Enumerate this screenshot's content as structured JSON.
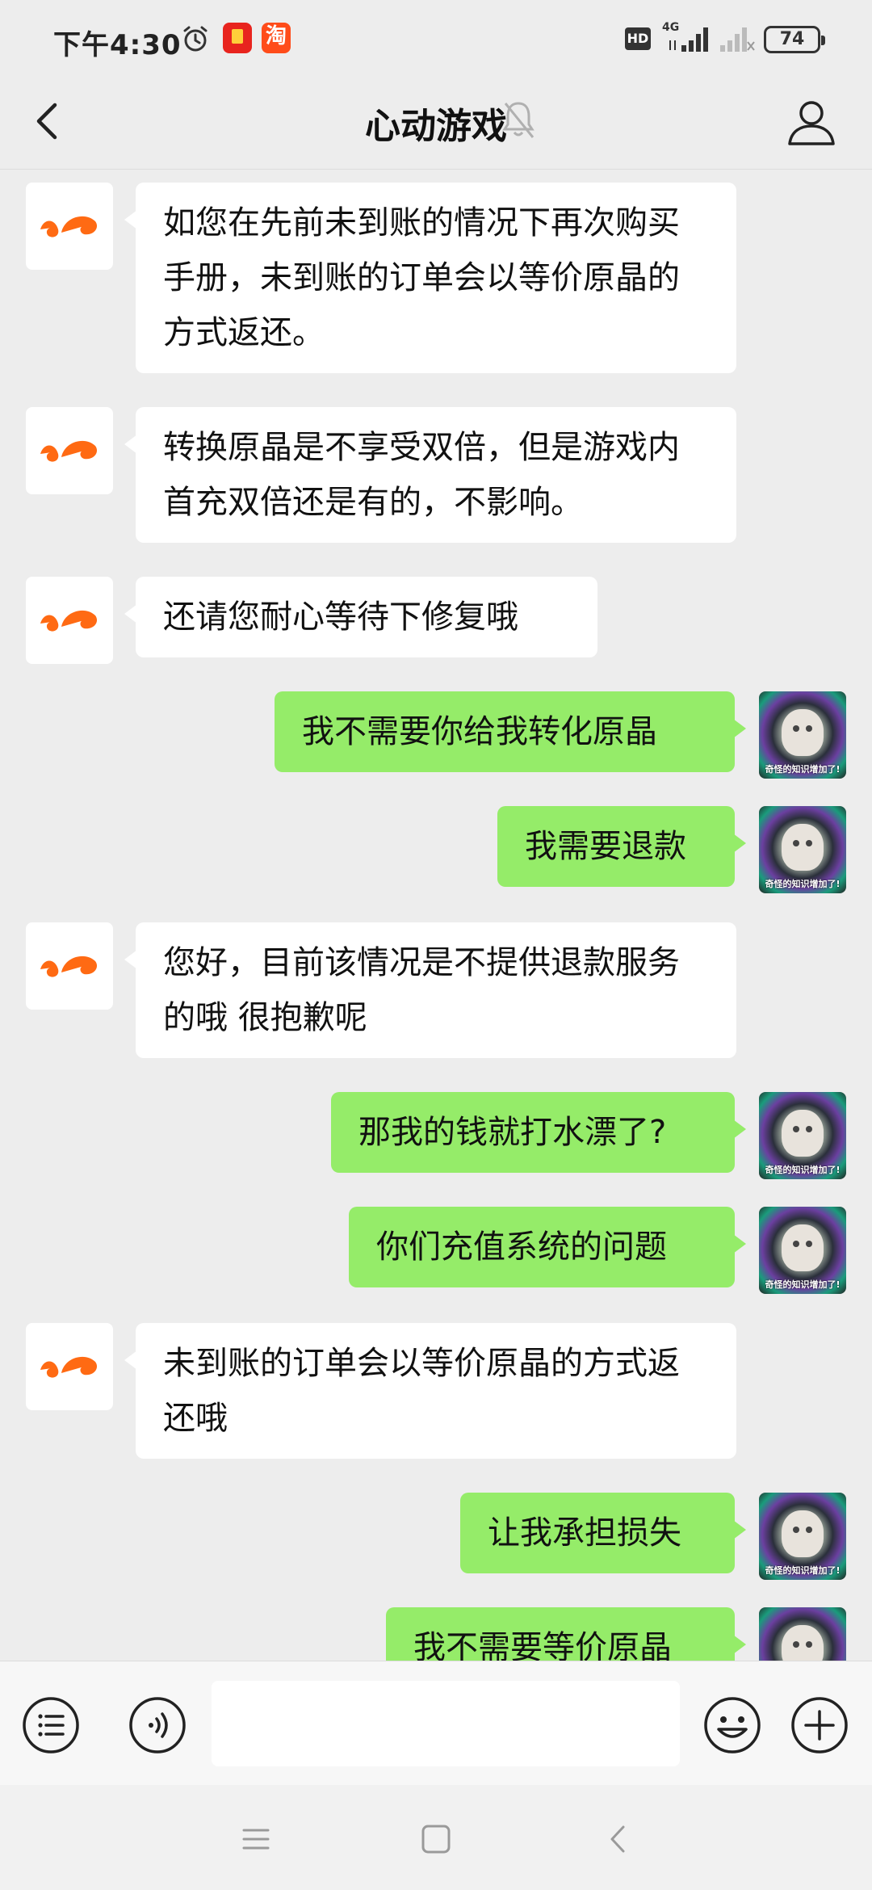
{
  "status_bar": {
    "time": "下午4:30",
    "hd": "HD",
    "network": "4G",
    "battery": "74",
    "taobao_glyph": "淘"
  },
  "nav": {
    "title": "心动游戏",
    "back_icon": "chevron-left-icon",
    "mute_icon": "bell-off-icon",
    "profile_icon": "person-icon"
  },
  "messages": [
    {
      "from": "business",
      "text": "如您在先前未到账的情况下再次购买手册，未到账的订单会以等价原晶的方式返还。"
    },
    {
      "from": "business",
      "text": "转换原晶是不享受双倍，但是游戏内首充双倍还是有的，不影响。"
    },
    {
      "from": "business",
      "text": "还请您耐心等待下修复哦"
    },
    {
      "from": "me",
      "text": "我不需要你给我转化原晶"
    },
    {
      "from": "me",
      "text": "我需要退款"
    },
    {
      "from": "business",
      "text": "您好，目前该情况是不提供退款服务的哦 很抱歉呢"
    },
    {
      "from": "me",
      "text": "那我的钱就打水漂了?"
    },
    {
      "from": "me",
      "text": "你们充值系统的问题"
    },
    {
      "from": "business",
      "text": "未到账的订单会以等价原晶的方式返还哦"
    },
    {
      "from": "me",
      "text": "让我承担损失"
    },
    {
      "from": "me",
      "text": "我不需要等价原晶"
    }
  ],
  "my_avatar_caption": "奇怪的知识增加了!",
  "input_bar": {
    "menu_icon": "list-icon",
    "voice_icon": "voice-icon",
    "input_value": "",
    "emoji_icon": "emoji-icon",
    "plus_icon": "plus-icon"
  },
  "colors": {
    "background": "#ededed",
    "bubble_me": "#95ec69",
    "bubble_other": "#ffffff",
    "brand_orange": "#ff6a13"
  }
}
